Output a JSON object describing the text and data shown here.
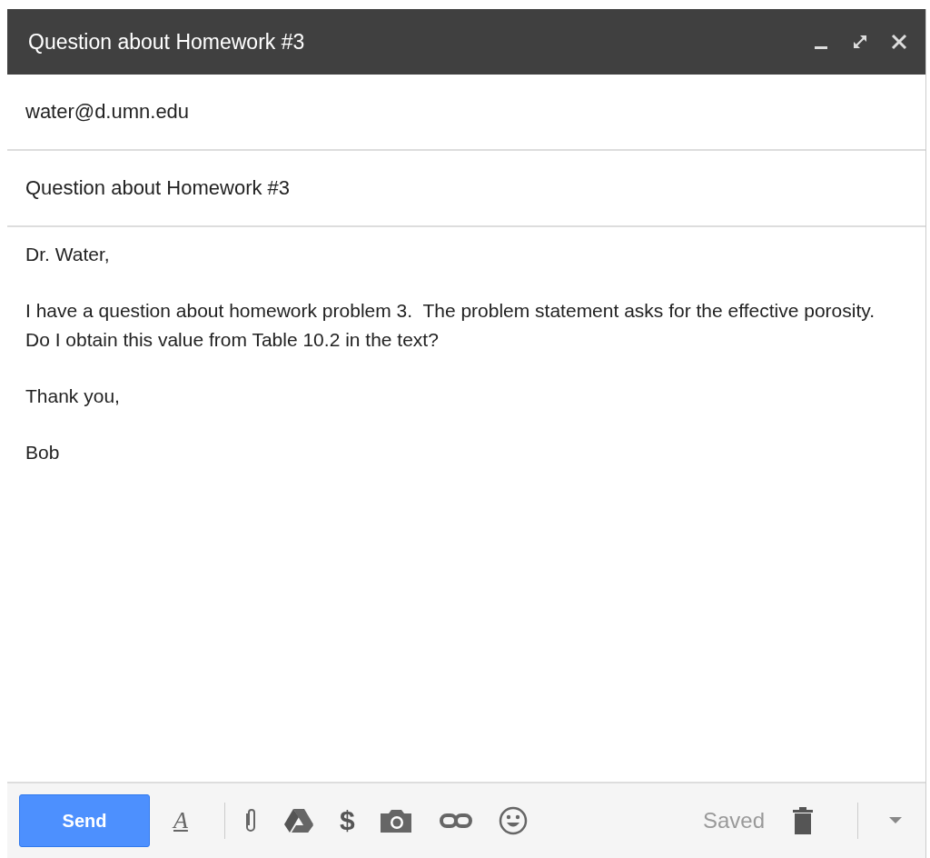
{
  "window": {
    "title": "Question about Homework #3"
  },
  "to": {
    "value": "water@d.umn.edu"
  },
  "subject": {
    "value": "Question about Homework #3"
  },
  "body": [
    "Dr. Water,",
    "I have a question about homework problem 3.  The problem statement asks for the effective porosity.  Do I obtain this value from Table 10.2 in the text?",
    "Thank you,",
    "Bob"
  ],
  "toolbar": {
    "send": "Send",
    "format": "A",
    "money": "$",
    "status": "Saved"
  }
}
